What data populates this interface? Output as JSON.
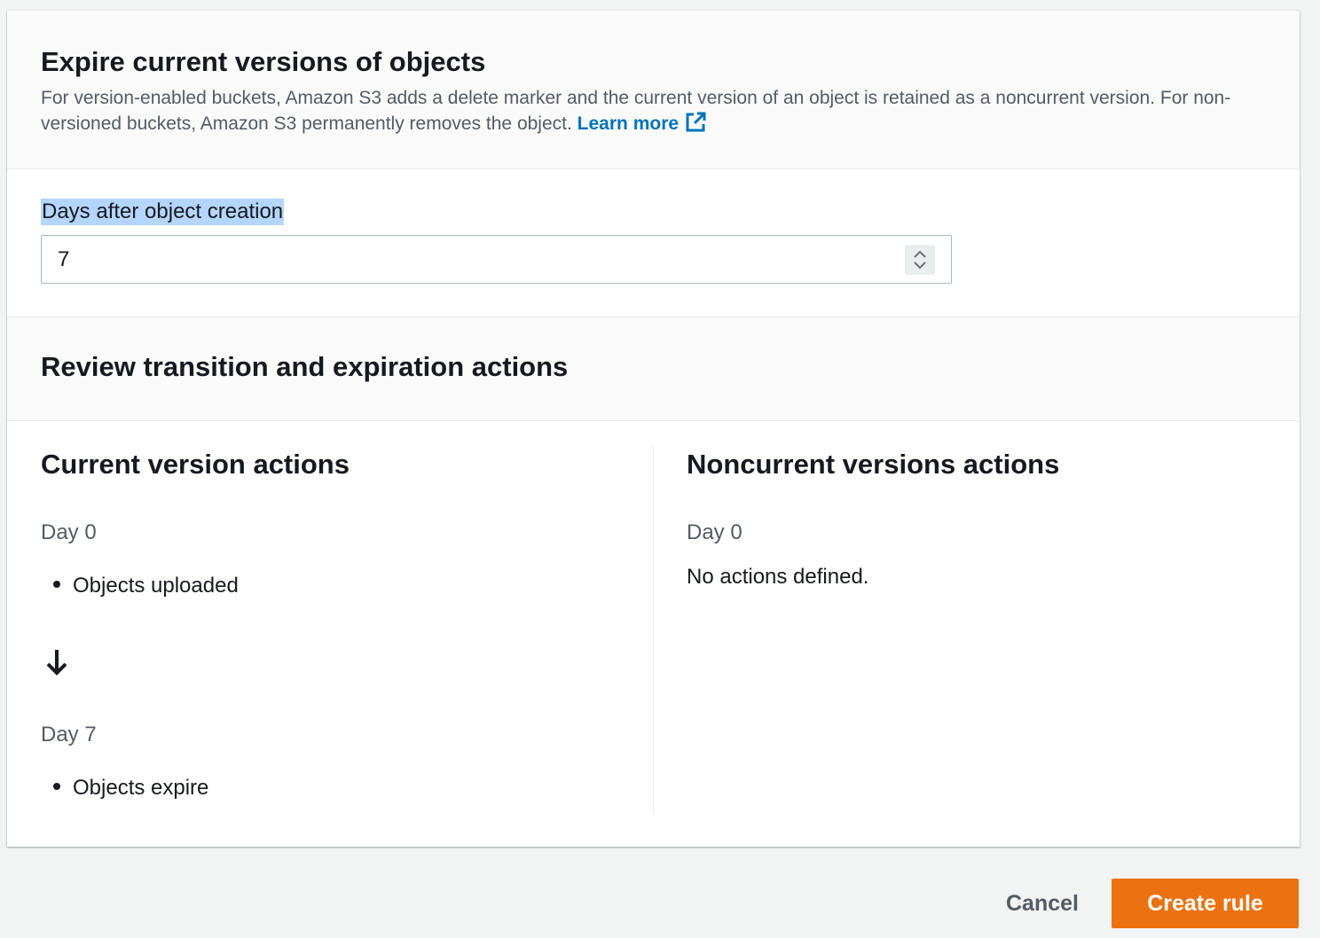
{
  "expire_section": {
    "title": "Expire current versions of objects",
    "description": "For version-enabled buckets, Amazon S3 adds a delete marker and the current version of an object is retained as a noncurrent version. For non-versioned buckets, Amazon S3 permanently removes the object.",
    "learn_more": "Learn more",
    "learn_more_icon": "external-link-icon",
    "days_label": "Days after object creation",
    "days_value": "7"
  },
  "review_section": {
    "title": "Review transition and expiration actions",
    "current": {
      "title": "Current version actions",
      "day_start": "Day 0",
      "start_action": "Objects uploaded",
      "arrow_icon": "arrow-down-icon",
      "day_end": "Day 7",
      "end_action": "Objects expire"
    },
    "noncurrent": {
      "title": "Noncurrent versions actions",
      "day_start": "Day 0",
      "message": "No actions defined."
    }
  },
  "footer": {
    "cancel_label": "Cancel",
    "create_label": "Create rule"
  },
  "colors": {
    "link": "#0073bb",
    "primary_button": "#ec7211",
    "selection_highlight": "#b4d5fe"
  }
}
